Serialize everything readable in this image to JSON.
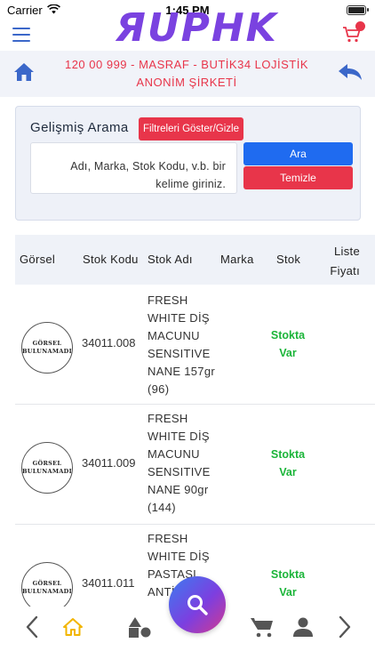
{
  "status_bar": {
    "carrier": "Carrier",
    "time": "1:45 PM"
  },
  "header": {
    "logo_text": "ЯUPHK"
  },
  "company": {
    "title": "120 00 999 - MASRAF - BUTİK34 LOJİSTİK ANONİM ŞİRKETİ"
  },
  "search": {
    "heading": "Gelişmiş Arama",
    "filter_toggle_label": "Filtreleri Göster/Gizle",
    "placeholder": "Adı, Marka, Stok Kodu, v.b. bir kelime giriniz.",
    "search_button": "Ara",
    "clear_button": "Temizle"
  },
  "table": {
    "columns": [
      "Görsel",
      "Stok Kodu",
      "Stok Adı",
      "Marka",
      "Stok",
      "Liste Fiyatı"
    ],
    "image_placeholder_line1": "GÖRSEL",
    "image_placeholder_line2": "BULUNAMADI",
    "rows": [
      {
        "code": "34011.008",
        "name": "FRESH WHITE DİŞ MACUNU SENSITIVE NANE 157gr (96)",
        "brand": "",
        "stock": "Stokta Var"
      },
      {
        "code": "34011.009",
        "name": "FRESH WHITE DİŞ MACUNU SENSITIVE NANE 90gr (144)",
        "brand": "",
        "stock": "Stokta Var"
      },
      {
        "code": "34011.011",
        "name": "FRESH WHITE DİŞ PASTASI ANTİ",
        "brand": "",
        "stock": "Stokta Var"
      }
    ]
  },
  "bottom_nav": [
    "back-icon",
    "home-icon",
    "categories-icon",
    "cart-icon",
    "user-icon",
    "forward-icon"
  ],
  "colors": {
    "accent_blue": "#1f6bf0",
    "accent_red": "#e8354a",
    "stock_green": "#1cb53a",
    "logo_purple": "#7a42e0"
  }
}
